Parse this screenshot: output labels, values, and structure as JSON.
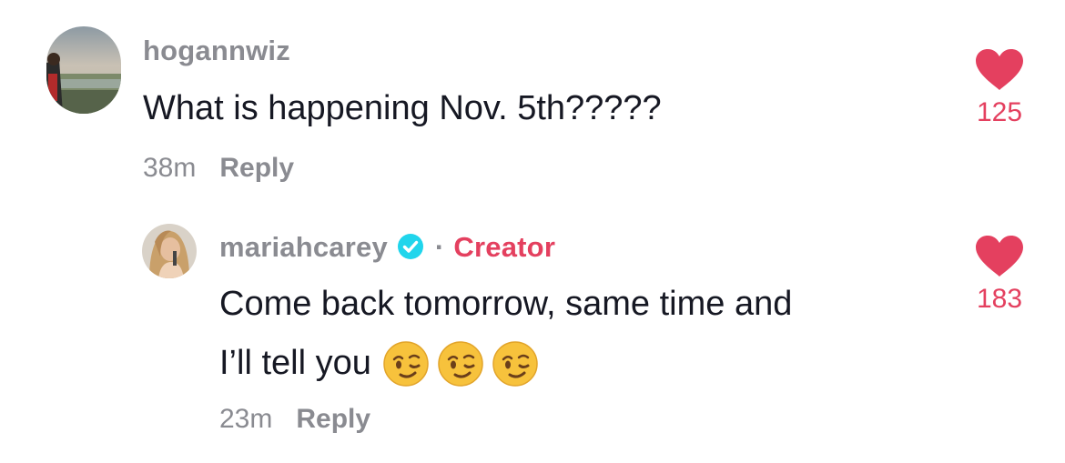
{
  "comments": [
    {
      "username": "hogannwiz",
      "text": "What is happening Nov. 5th?????",
      "time": "38m",
      "reply_label": "Reply",
      "likes": "125",
      "avatar_icon": "user-avatar-landscape"
    }
  ],
  "reply": {
    "username": "mariahcarey",
    "verified_icon": "verified-check-icon",
    "separator": "·",
    "badge": "Creator",
    "text_line1": "Come back tomorrow, same time and",
    "text_line2": "I’ll tell you",
    "emojis": [
      "winking-face",
      "winking-face",
      "winking-face"
    ],
    "time": "23m",
    "reply_label": "Reply",
    "likes": "183",
    "avatar_icon": "user-avatar-portrait"
  },
  "colors": {
    "like_red": "#e4405f",
    "meta_gray": "#8a8b91",
    "text_dark": "#161823",
    "verified_blue": "#20d5ec"
  }
}
